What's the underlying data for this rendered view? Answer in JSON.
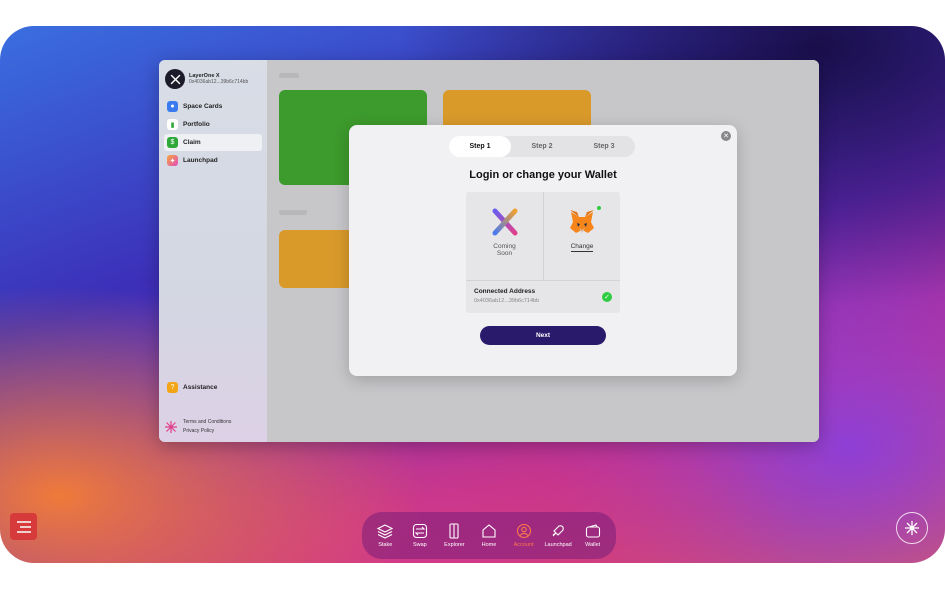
{
  "profile": {
    "name": "LayerOne X",
    "address": "0x4036ab12...39b6c714bb"
  },
  "sidebar": {
    "items": [
      {
        "label": "Space Cards",
        "color": "#3b7bf0"
      },
      {
        "label": "Portfolio",
        "color": "#ffffff"
      },
      {
        "label": "Claim",
        "color": "#2fa83a"
      },
      {
        "label": "Launchpad",
        "color": "#e04ac0"
      }
    ],
    "assistance": "Assistance",
    "terms": "Terms and Conditions",
    "privacy": "Privacy Policy"
  },
  "modal": {
    "steps": [
      "Step 1",
      "Step 2",
      "Step 3"
    ],
    "title": "Login or change your Wallet",
    "option_left": "Coming Soon",
    "option_right": "Change",
    "connected_title": "Connected Address",
    "connected_address": "0x4036ab12...39b6c714bb",
    "next": "Next"
  },
  "dock": {
    "items": [
      {
        "label": "Stake",
        "icon": "layers-icon"
      },
      {
        "label": "Swap",
        "icon": "swap-icon"
      },
      {
        "label": "Explorer",
        "icon": "explorer-icon"
      },
      {
        "label": "Home",
        "icon": "home-icon"
      },
      {
        "label": "Account",
        "icon": "account-icon"
      },
      {
        "label": "Launchpad",
        "icon": "rocket-icon"
      },
      {
        "label": "Wallet",
        "icon": "wallet-icon"
      }
    ]
  },
  "colors": {
    "accent": "#2a1a6c",
    "success": "#2ecc40",
    "active_dock": "#ff7a4a"
  }
}
